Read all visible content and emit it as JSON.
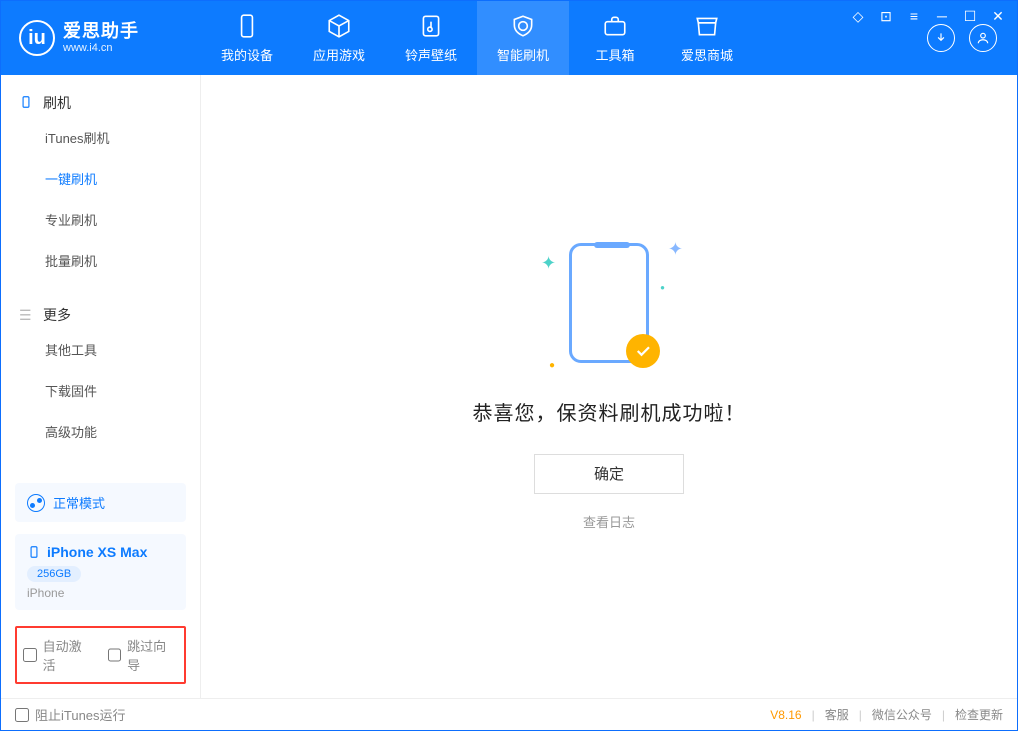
{
  "app": {
    "name_zh": "爱思助手",
    "name_en": "www.i4.cn",
    "logo_letter": "iu"
  },
  "nav": {
    "items": [
      {
        "label": "我的设备"
      },
      {
        "label": "应用游戏"
      },
      {
        "label": "铃声壁纸"
      },
      {
        "label": "智能刷机"
      },
      {
        "label": "工具箱"
      },
      {
        "label": "爱思商城"
      }
    ],
    "active_index": 3
  },
  "sidebar": {
    "sections": [
      {
        "title": "刷机",
        "items": [
          "iTunes刷机",
          "一键刷机",
          "专业刷机",
          "批量刷机"
        ],
        "active_index": 1
      },
      {
        "title": "更多",
        "items": [
          "其他工具",
          "下载固件",
          "高级功能"
        ]
      }
    ],
    "mode_label": "正常模式",
    "device": {
      "name": "iPhone XS Max",
      "capacity": "256GB",
      "type": "iPhone"
    },
    "options": {
      "auto_activate": "自动激活",
      "skip_guide": "跳过向导"
    }
  },
  "main": {
    "success_text": "恭喜您，保资料刷机成功啦！",
    "ok_label": "确定",
    "log_link": "查看日志"
  },
  "status": {
    "block_itunes": "阻止iTunes运行",
    "version": "V8.16",
    "links": [
      "客服",
      "微信公众号",
      "检查更新"
    ]
  }
}
